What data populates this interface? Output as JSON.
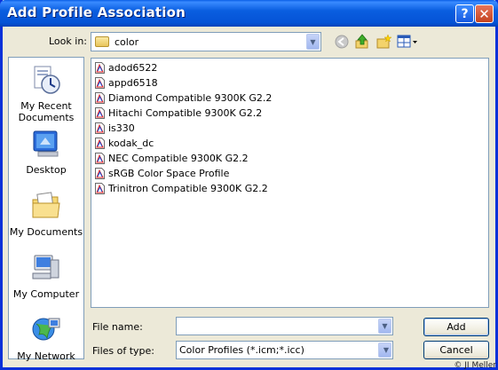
{
  "window": {
    "title": "Add Profile Association",
    "help_label": "?",
    "close_label": "✕"
  },
  "lookin": {
    "label": "Look in:",
    "value": "color"
  },
  "places": [
    {
      "label_l1": "My Recent",
      "label_l2": "Documents"
    },
    {
      "label_l1": "Desktop"
    },
    {
      "label_l1": "My Documents"
    },
    {
      "label_l1": "My Computer"
    },
    {
      "label_l1": "My Network"
    }
  ],
  "files": [
    "adod6522",
    "appd6518",
    "Diamond Compatible 9300K G2.2",
    "Hitachi Compatible 9300K G2.2",
    "is330",
    "kodak_dc",
    "NEC Compatible 9300K G2.2",
    "sRGB Color Space Profile",
    "Trinitron Compatible 9300K G2.2"
  ],
  "filename": {
    "label": "File name:",
    "value": ""
  },
  "filetype": {
    "label": "Files of type:",
    "value": "Color Profiles (*.icm;*.icc)"
  },
  "buttons": {
    "add": "Add",
    "cancel": "Cancel"
  },
  "watermark": "© JI Meller"
}
